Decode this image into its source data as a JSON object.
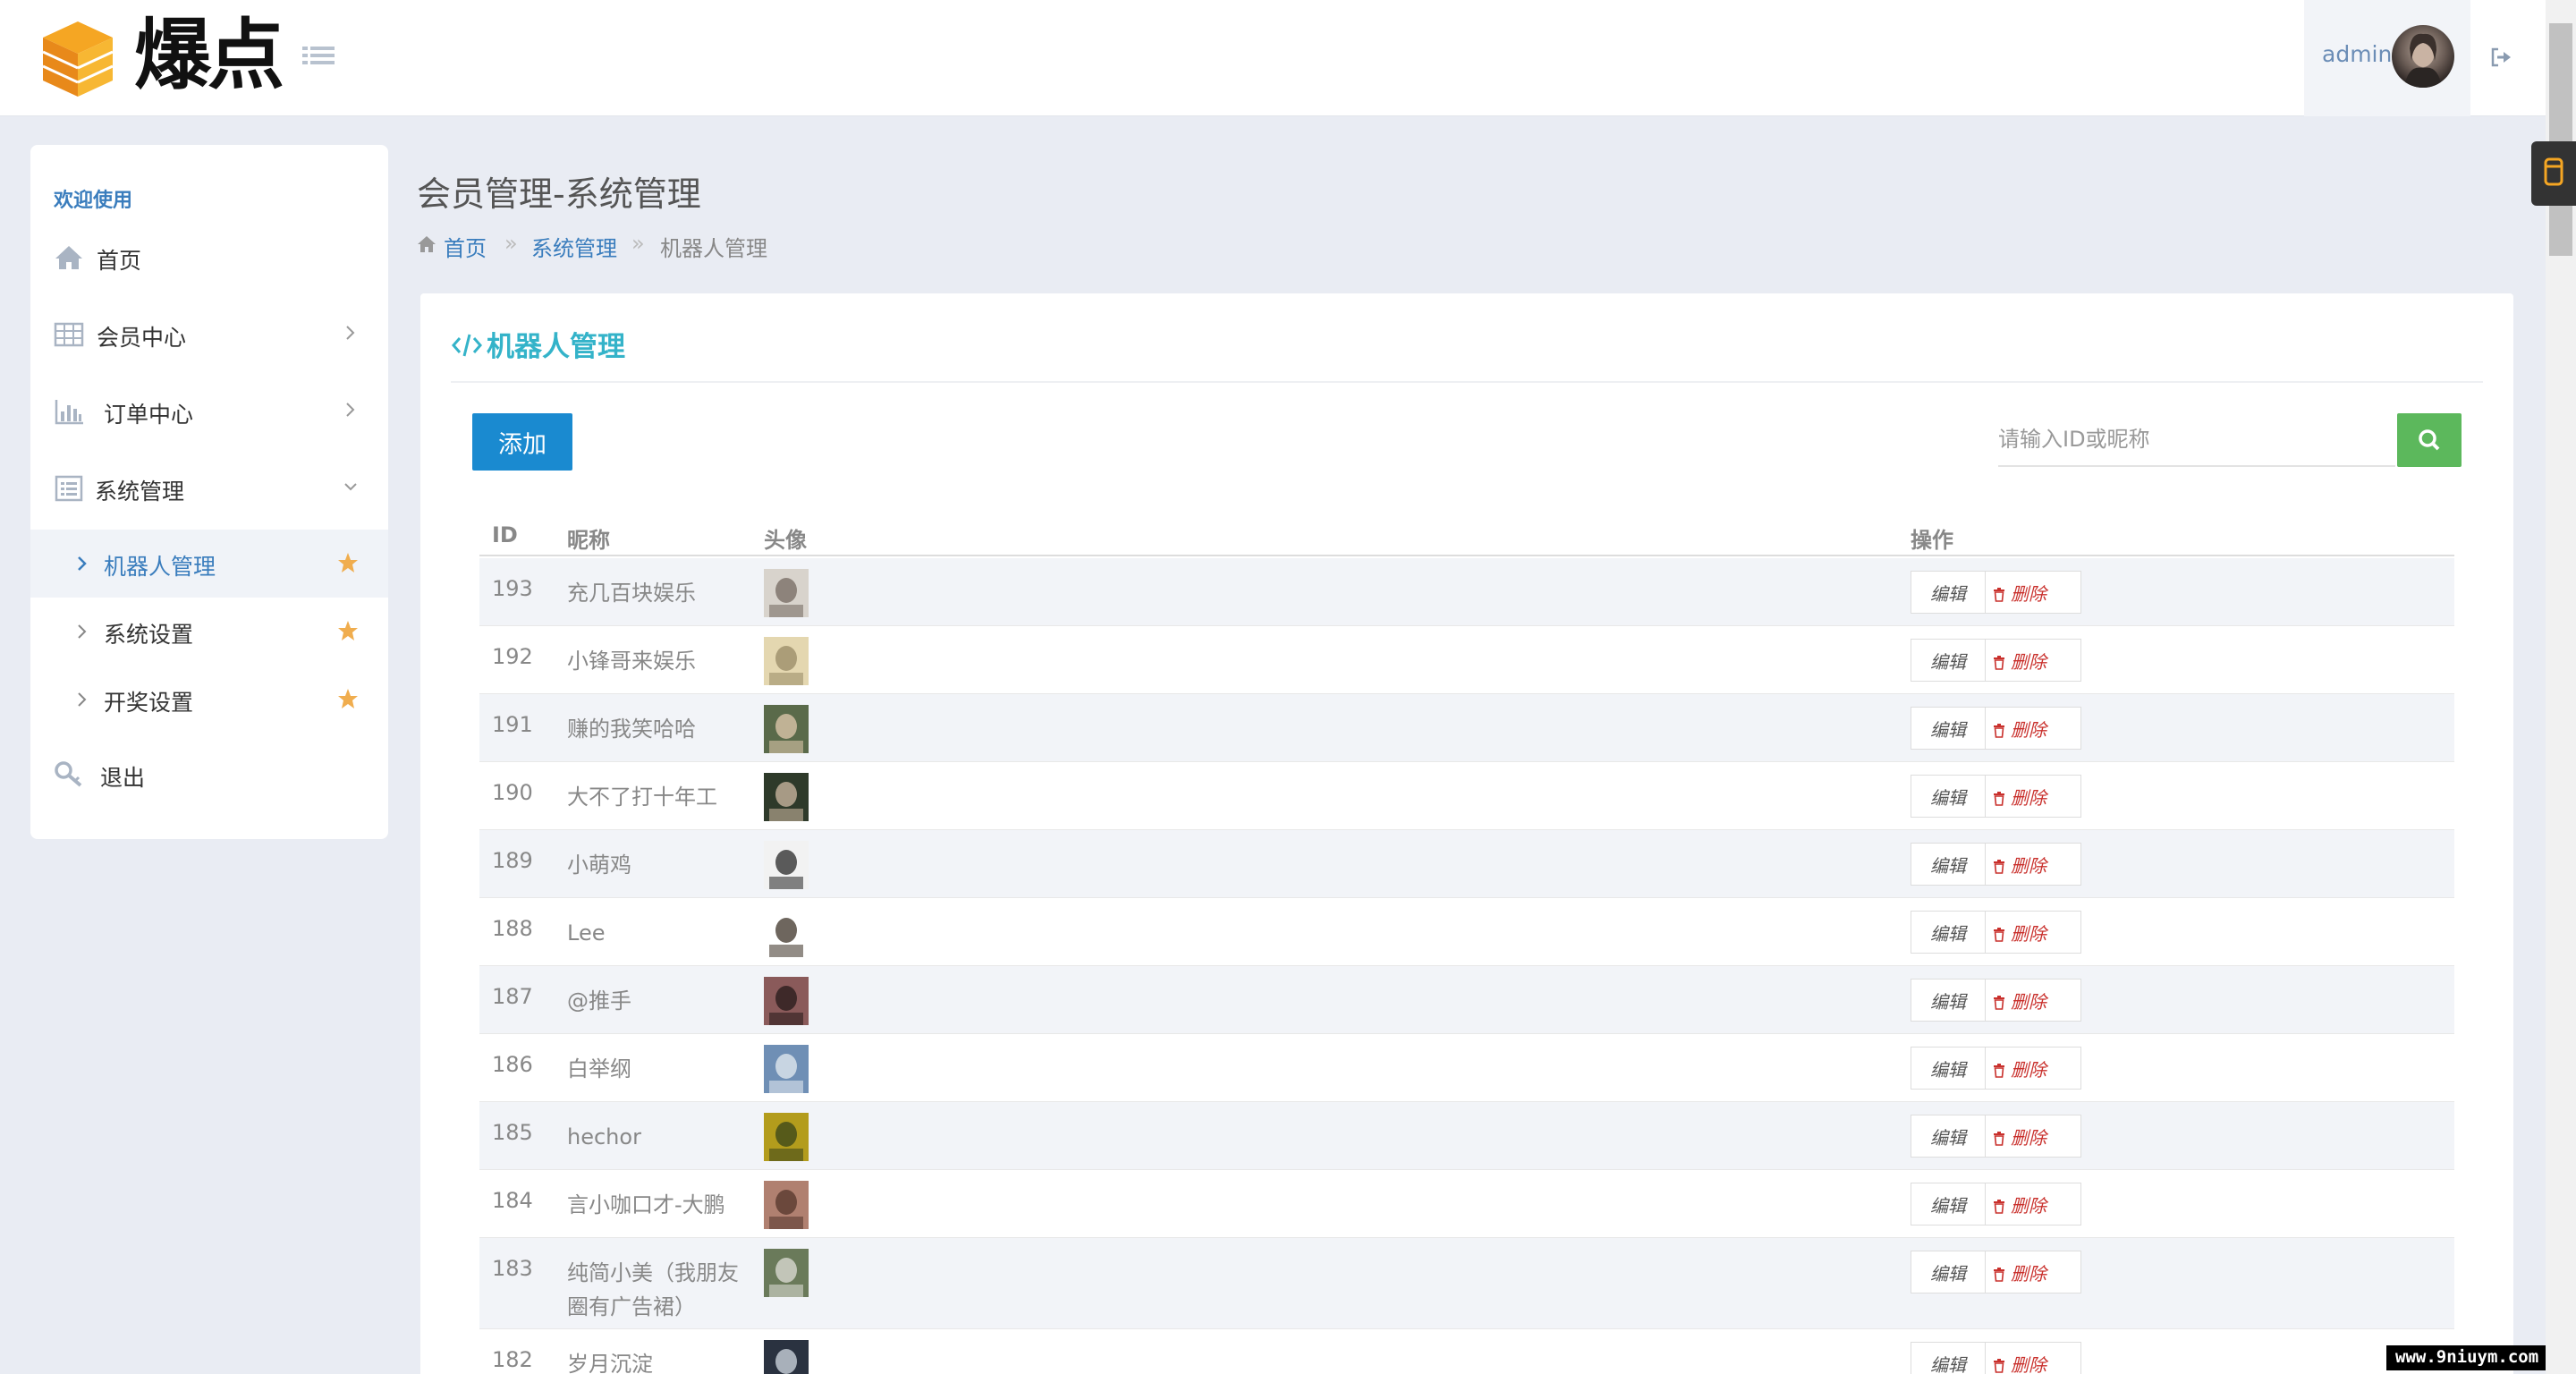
{
  "header": {
    "logo_text": "爆点",
    "user_name": "admin"
  },
  "sidebar": {
    "welcome": "欢迎使用",
    "items": [
      {
        "label": "首页",
        "icon": "home-icon"
      },
      {
        "label": "会员中心",
        "icon": "table-icon"
      },
      {
        "label": "订单中心",
        "icon": "bar-chart-icon"
      },
      {
        "label": "系统管理",
        "icon": "list-alt-icon"
      }
    ],
    "sub_items": [
      {
        "label": "机器人管理",
        "active": true
      },
      {
        "label": "系统设置",
        "active": false
      },
      {
        "label": "开奖设置",
        "active": false
      }
    ],
    "logout": "退出"
  },
  "page": {
    "title": "会员管理-系统管理",
    "breadcrumb": {
      "home": "首页",
      "sep": "»",
      "section": "系统管理",
      "current": "机器人管理"
    }
  },
  "card": {
    "title": "机器人管理",
    "add_label": "添加",
    "search_placeholder": "请输入ID或昵称"
  },
  "table": {
    "headers": {
      "id": "ID",
      "nickname": "昵称",
      "avatar": "头像",
      "ops": "操作"
    },
    "edit_label": "编辑",
    "delete_label": "删除",
    "rows": [
      {
        "id": "193",
        "nickname": "充几百块娱乐"
      },
      {
        "id": "192",
        "nickname": "小锋哥来娱乐"
      },
      {
        "id": "191",
        "nickname": "赚的我笑哈哈"
      },
      {
        "id": "190",
        "nickname": "大不了打十年工"
      },
      {
        "id": "189",
        "nickname": "小萌鸡"
      },
      {
        "id": "188",
        "nickname": "Lee"
      },
      {
        "id": "187",
        "nickname": "@推手"
      },
      {
        "id": "186",
        "nickname": "白举纲"
      },
      {
        "id": "185",
        "nickname": "hechor"
      },
      {
        "id": "184",
        "nickname": "言小咖口才-大鹏"
      },
      {
        "id": "183",
        "nickname": "纯简小美（我朋友圈有广告裙）"
      },
      {
        "id": "182",
        "nickname": "岁月沉淀"
      }
    ]
  },
  "watermark": "www.9niuym.com",
  "colors": {
    "accent_blue": "#1a8ad0",
    "title_teal": "#34b3c9",
    "search_green": "#5cb85c",
    "delete_red": "#c9302c",
    "star": "#f0ad4e"
  }
}
